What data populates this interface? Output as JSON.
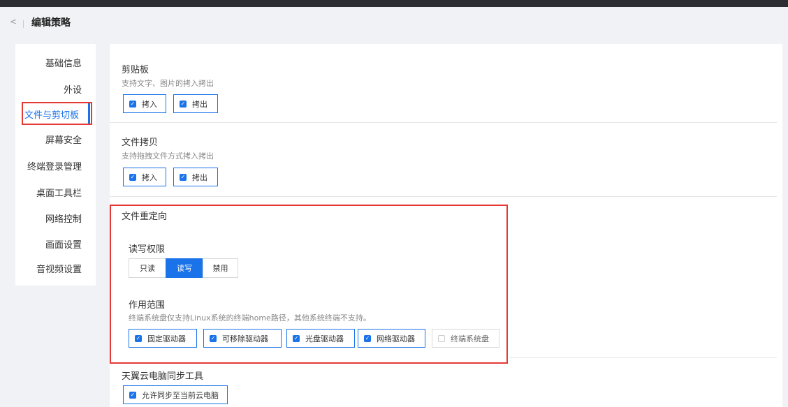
{
  "header": {
    "back_glyph": "<",
    "title": "编辑策略"
  },
  "sidebar": {
    "items": [
      {
        "label": "基础信息"
      },
      {
        "label": "外设"
      },
      {
        "label": "文件与剪切板"
      },
      {
        "label": "屏幕安全"
      },
      {
        "label": "终端登录管理"
      },
      {
        "label": "桌面工具栏"
      },
      {
        "label": "网络控制"
      },
      {
        "label": "画面设置"
      },
      {
        "label": "音视频设置"
      }
    ],
    "active_index": 2
  },
  "clipboard": {
    "title": "剪贴板",
    "desc": "支持文字、图片的拷入拷出",
    "in_label": "拷入",
    "out_label": "拷出"
  },
  "file_copy": {
    "title": "文件拷贝",
    "desc": "支持拖拽文件方式拷入拷出",
    "in_label": "拷入",
    "out_label": "拷出"
  },
  "redirect": {
    "title": "文件重定向",
    "perm_label": "读写权限",
    "perm_options": [
      "只读",
      "读写",
      "禁用"
    ],
    "perm_selected": "读写",
    "scope_label": "作用范围",
    "scope_desc": "终端系统盘仅支持Linux系统的终端home路径，其他系统终端不支持。",
    "drives": [
      {
        "label": "固定驱动器",
        "checked": true
      },
      {
        "label": "可移除驱动器",
        "checked": true
      },
      {
        "label": "光盘驱动器",
        "checked": true
      },
      {
        "label": "网络驱动器",
        "checked": true
      },
      {
        "label": "终端系统盘",
        "checked": false
      }
    ]
  },
  "sync_tool": {
    "title": "天翼云电脑同步工具",
    "allow_label": "允许同步至当前云电脑"
  },
  "colors": {
    "accent": "#1a73e8",
    "highlight": "#e53935",
    "topbar": "#2b2d33"
  }
}
